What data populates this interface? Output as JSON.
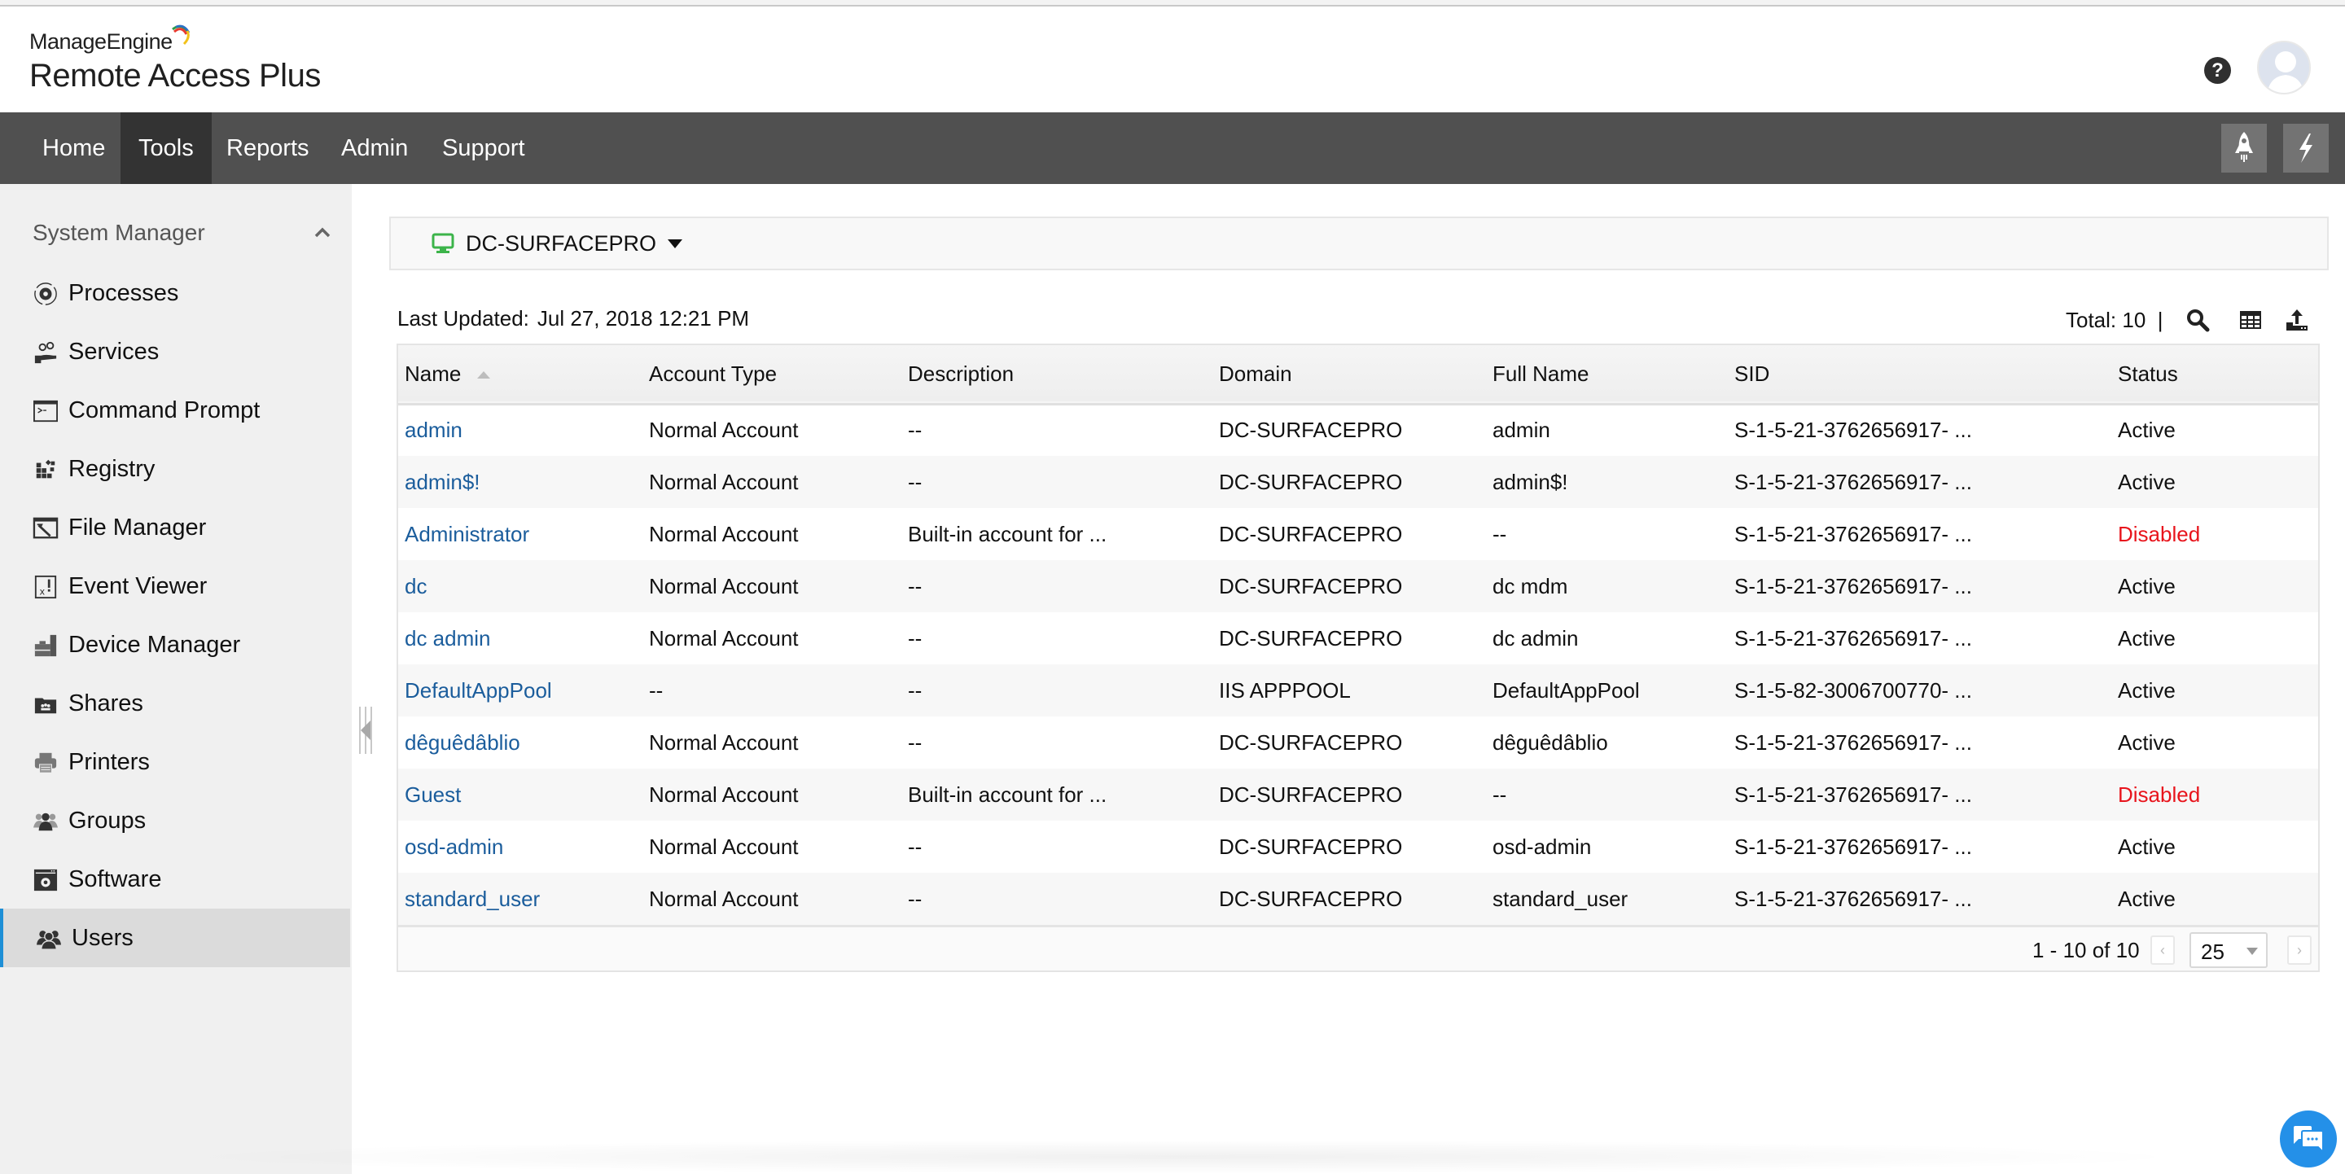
{
  "header": {
    "brand": "ManageEngine",
    "product": "Remote Access Plus",
    "help_icon": "question-circle-icon",
    "avatar_icon": "user-avatar-icon"
  },
  "nav": {
    "items": [
      {
        "label": "Home",
        "active": false
      },
      {
        "label": "Tools",
        "active": true
      },
      {
        "label": "Reports",
        "active": false
      },
      {
        "label": "Admin",
        "active": false
      },
      {
        "label": "Support",
        "active": false
      }
    ],
    "right_buttons": [
      {
        "icon": "rocket-icon"
      },
      {
        "icon": "lightning-icon"
      }
    ]
  },
  "sidebar": {
    "title": "System Manager",
    "items": [
      {
        "label": "Processes",
        "icon": "processes-gear-icon"
      },
      {
        "label": "Services",
        "icon": "services-hand-gears-icon"
      },
      {
        "label": "Command Prompt",
        "icon": "command-prompt-icon"
      },
      {
        "label": "Registry",
        "icon": "registry-blocks-icon"
      },
      {
        "label": "File Manager",
        "icon": "file-manager-icon"
      },
      {
        "label": "Event Viewer",
        "icon": "event-viewer-icon"
      },
      {
        "label": "Device Manager",
        "icon": "device-manager-icon"
      },
      {
        "label": "Shares",
        "icon": "shares-folder-icon"
      },
      {
        "label": "Printers",
        "icon": "printer-icon"
      },
      {
        "label": "Groups",
        "icon": "groups-icon"
      },
      {
        "label": "Software",
        "icon": "software-icon"
      },
      {
        "label": "Users",
        "icon": "users-icon",
        "active": true
      }
    ]
  },
  "device": {
    "name": "DC-SURFACEPRO",
    "status_color": "#3cb44a"
  },
  "toolbar": {
    "last_updated_label": "Last Updated:",
    "last_updated_value": "Jul 27, 2018 12:21 PM",
    "total_label": "Total: 10  |"
  },
  "table": {
    "columns": [
      "Name",
      "Account Type",
      "Description",
      "Domain",
      "Full Name",
      "SID",
      "Status"
    ],
    "sort_column": "Name",
    "sort_direction": "ascending",
    "rows": [
      {
        "name": "admin",
        "account_type": "Normal Account",
        "description": "--",
        "domain": "DC-SURFACEPRO",
        "full_name": "admin",
        "sid": "S-1-5-21-3762656917- ...",
        "status": "Active"
      },
      {
        "name": "admin$!",
        "account_type": "Normal Account",
        "description": "--",
        "domain": "DC-SURFACEPRO",
        "full_name": "admin$!",
        "sid": "S-1-5-21-3762656917- ...",
        "status": "Active"
      },
      {
        "name": "Administrator",
        "account_type": "Normal Account",
        "description": "Built-in account for ...",
        "domain": "DC-SURFACEPRO",
        "full_name": "--",
        "sid": "S-1-5-21-3762656917- ...",
        "status": "Disabled"
      },
      {
        "name": "dc",
        "account_type": "Normal Account",
        "description": "--",
        "domain": "DC-SURFACEPRO",
        "full_name": "dc mdm",
        "sid": "S-1-5-21-3762656917- ...",
        "status": "Active"
      },
      {
        "name": "dc admin",
        "account_type": "Normal Account",
        "description": "--",
        "domain": "DC-SURFACEPRO",
        "full_name": "dc admin",
        "sid": "S-1-5-21-3762656917- ...",
        "status": "Active"
      },
      {
        "name": "DefaultAppPool",
        "account_type": "--",
        "description": "--",
        "domain": "IIS APPPOOL",
        "full_name": "DefaultAppPool",
        "sid": "S-1-5-82-3006700770- ...",
        "status": "Active"
      },
      {
        "name": "dêguêdâblio",
        "account_type": "Normal Account",
        "description": "--",
        "domain": "DC-SURFACEPRO",
        "full_name": "dêguêdâblio",
        "sid": "S-1-5-21-3762656917- ...",
        "status": "Active"
      },
      {
        "name": "Guest",
        "account_type": "Normal Account",
        "description": "Built-in account for ...",
        "domain": "DC-SURFACEPRO",
        "full_name": "--",
        "sid": "S-1-5-21-3762656917- ...",
        "status": "Disabled"
      },
      {
        "name": "osd-admin",
        "account_type": "Normal Account",
        "description": "--",
        "domain": "DC-SURFACEPRO",
        "full_name": "osd-admin",
        "sid": "S-1-5-21-3762656917- ...",
        "status": "Active"
      },
      {
        "name": "standard_user",
        "account_type": "Normal Account",
        "description": "--",
        "domain": "DC-SURFACEPRO",
        "full_name": "standard_user",
        "sid": "S-1-5-21-3762656917- ...",
        "status": "Active"
      }
    ]
  },
  "pagination": {
    "range_text": "1 - 10 of 10",
    "prev": "‹",
    "next": "›",
    "page_size": "25"
  },
  "colors": {
    "link": "#1b5d9c",
    "disabled_status": "#e8141c",
    "nav_bg": "#505050",
    "nav_active_bg": "#333333",
    "sidebar_active_accent": "#1e8fd6",
    "chat_button": "#2490e8"
  },
  "chat": {
    "icon": "chat-bubbles-icon"
  }
}
